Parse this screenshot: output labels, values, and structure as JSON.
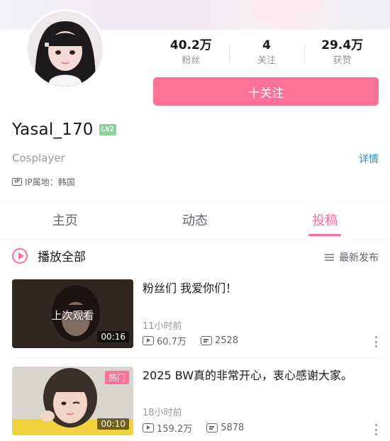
{
  "profile": {
    "username": "Yasal_170",
    "level": "LV2",
    "bio": "Cosplayer",
    "detail_link": "详情",
    "ip_icon": "IP",
    "ip_location": "IP属地：韩国"
  },
  "stats": [
    {
      "value": "40.2万",
      "label": "粉丝"
    },
    {
      "value": "4",
      "label": "关注"
    },
    {
      "value": "29.4万",
      "label": "获赞"
    }
  ],
  "follow_button": "十关注",
  "tabs": [
    {
      "label": "主页",
      "active": false
    },
    {
      "label": "动态",
      "active": false
    },
    {
      "label": "投稿",
      "active": true
    }
  ],
  "list_header": {
    "play_all": "播放全部",
    "sort": "最新发布"
  },
  "videos": [
    {
      "title": "粉丝们 我爱你们！",
      "overlay": "上次观看",
      "duration": "00:16",
      "time": "11小时前",
      "plays": "60.7万",
      "danmaku": "2528"
    },
    {
      "title": "2025 BW真的非常开心，衷心感谢大家。",
      "badge": "热门",
      "duration": "00:10",
      "time": "18小时前",
      "plays": "159.2万",
      "danmaku": "5878"
    }
  ],
  "colors": {
    "accent": "#fb7299",
    "link": "#1b8fd6",
    "level_badge": "#8bd29b"
  }
}
